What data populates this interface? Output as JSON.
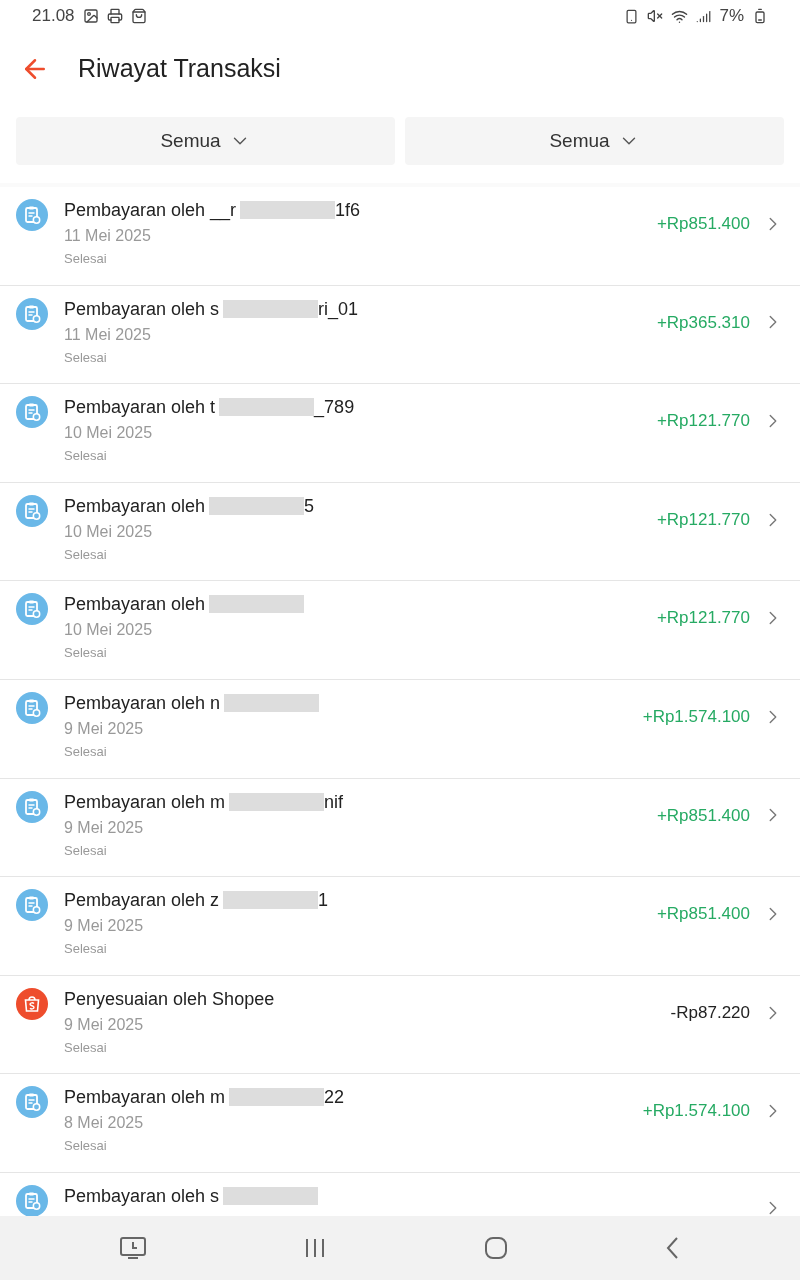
{
  "status_bar": {
    "time": "21.08",
    "battery": "7%"
  },
  "header": {
    "title": "Riwayat Transaksi"
  },
  "filters": [
    {
      "label": "Semua"
    },
    {
      "label": "Semua"
    }
  ],
  "transactions": [
    {
      "kind": "payment",
      "title": "Pembayaran oleh __r",
      "title_end": "1f6",
      "redacted": true,
      "date": "11 Mei 2025",
      "status": "Selesai",
      "amount": "+Rp851.400"
    },
    {
      "kind": "payment",
      "title": "Pembayaran oleh s",
      "title_end": "ri_01",
      "redacted": true,
      "date": "11 Mei 2025",
      "status": "Selesai",
      "amount": "+Rp365.310"
    },
    {
      "kind": "payment",
      "title": "Pembayaran oleh t",
      "title_end": "_789",
      "redacted": true,
      "date": "10 Mei 2025",
      "status": "Selesai",
      "amount": "+Rp121.770"
    },
    {
      "kind": "payment",
      "title": "Pembayaran oleh",
      "title_end": "5",
      "redacted": true,
      "date": "10 Mei 2025",
      "status": "Selesai",
      "amount": "+Rp121.770"
    },
    {
      "kind": "payment",
      "title": "Pembayaran oleh",
      "redacted": true,
      "date": "10 Mei 2025",
      "status": "Selesai",
      "amount": "+Rp121.770"
    },
    {
      "kind": "payment",
      "title": "Pembayaran oleh n",
      "redacted": true,
      "date": "9 Mei 2025",
      "status": "Selesai",
      "amount": "+Rp1.574.100"
    },
    {
      "kind": "payment",
      "title": "Pembayaran oleh m",
      "title_end": "nif",
      "redacted": true,
      "date": "9 Mei 2025",
      "status": "Selesai",
      "amount": "+Rp851.400"
    },
    {
      "kind": "payment",
      "title": "Pembayaran oleh z",
      "title_end": "1",
      "redacted": true,
      "date": "9 Mei 2025",
      "status": "Selesai",
      "amount": "+Rp851.400"
    },
    {
      "kind": "adjustment",
      "title": "Penyesuaian oleh Shopee",
      "redacted": false,
      "date": "9 Mei 2025",
      "status": "Selesai",
      "amount": "-Rp87.220"
    },
    {
      "kind": "payment",
      "title": "Pembayaran oleh m",
      "title_end": "22",
      "redacted": true,
      "date": "8 Mei 2025",
      "status": "Selesai",
      "amount": "+Rp1.574.100"
    },
    {
      "kind": "payment",
      "title": "Pembayaran oleh s",
      "redacted": true
    }
  ]
}
